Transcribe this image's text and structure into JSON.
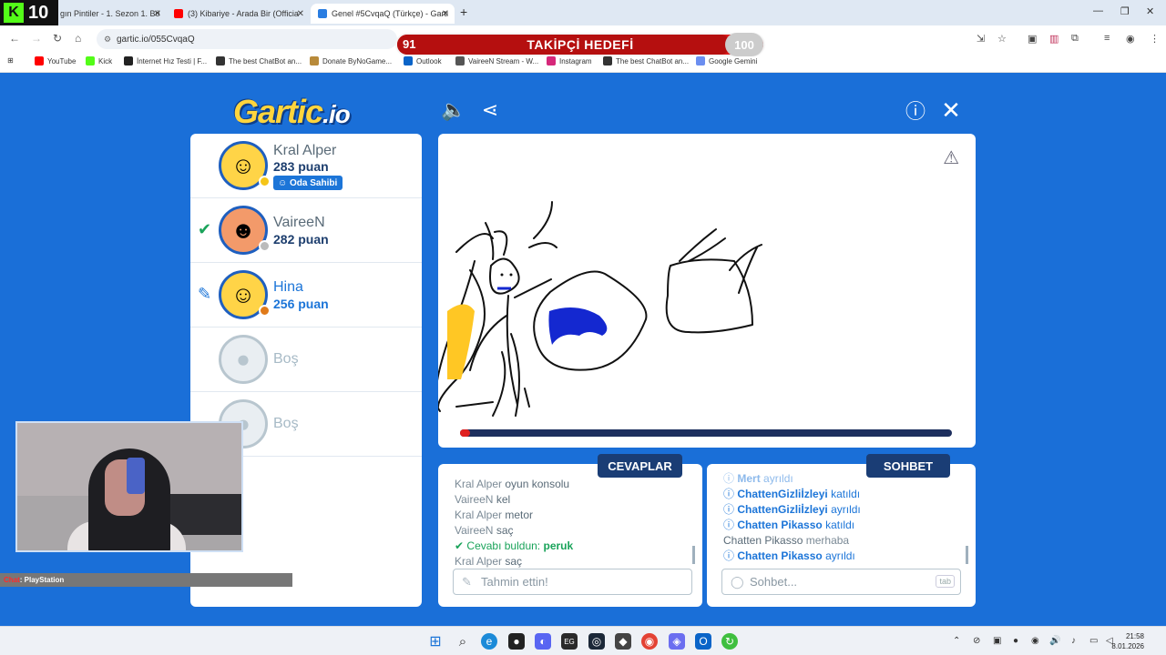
{
  "browser": {
    "tabs": [
      {
        "label": "gın Pintiler - 1. Sezon 1. Bö",
        "active": false
      },
      {
        "label": "(3) Kibariye - Arada Bir (Officia",
        "active": false
      },
      {
        "label": "Genel #5CvqaQ (Türkçe) - Garti",
        "active": true
      }
    ],
    "url": "gartic.io/055CvqaQ",
    "bookmarks": [
      "YouTube",
      "Kick",
      "İnternet Hız Testi | F...",
      "The best ChatBot an...",
      "Donate ByNoGame...",
      "Outlook",
      "VaireeN Stream - W...",
      "Instagram",
      "The best ChatBot an...",
      "Google Gemini"
    ]
  },
  "overlay": {
    "kick_count": "10",
    "goal_title": "TAKİPÇİ HEDEFİ",
    "goal_current": "91",
    "goal_target": "100",
    "goal_progress": 0.91
  },
  "game": {
    "logo_main": "Gartic",
    "logo_suffix": ".io",
    "players": [
      {
        "name": "Kral Alper",
        "points": "283 puan",
        "badge": "Oda Sahibi",
        "marker": "",
        "dot": "#f5c518"
      },
      {
        "name": "VaireeN",
        "points": "282 puan",
        "badge": "",
        "marker": "check",
        "dot": "#bbbbbb"
      },
      {
        "name": "Hina",
        "points": "256 puan",
        "badge": "",
        "marker": "pencil",
        "dot": "#e07a1a"
      },
      {
        "name": "Boş",
        "points": "",
        "badge": "",
        "marker": "",
        "dot": ""
      },
      {
        "name": "Boş",
        "points": "",
        "badge": "",
        "marker": "",
        "dot": ""
      }
    ],
    "timer_progress": 0.02,
    "answers": {
      "title": "CEVAPLAR",
      "placeholder": "Tahmin ettin!",
      "messages": [
        {
          "who": "Kral Alper",
          "text": "oyun konsolu"
        },
        {
          "who": "VaireeN",
          "text": "kel"
        },
        {
          "who": "Kral Alper",
          "text": "metor"
        },
        {
          "who": "VaireeN",
          "text": "saç"
        },
        {
          "who": "",
          "text": "Cevabı buldun:",
          "word": "peruk"
        },
        {
          "who": "Kral Alper",
          "text": "saç"
        }
      ]
    },
    "chat": {
      "title": "SOHBET",
      "placeholder": "Sohbet...",
      "tab_hint": "tab",
      "messages": [
        {
          "name": "Mert",
          "action": "ayrıldı",
          "system": true
        },
        {
          "name": "ChattenGizliİzleyi",
          "action": "katıldı",
          "system": true
        },
        {
          "name": "ChattenGizliİzleyi",
          "action": "ayrıldı",
          "system": true
        },
        {
          "name": "Chatten Pikasso",
          "action": "katıldı",
          "system": true
        },
        {
          "name": "Chatten Pikasso",
          "action": "merhaba",
          "system": false
        },
        {
          "name": "Chatten Pikasso",
          "action": "ayrıldı",
          "system": true
        }
      ]
    }
  },
  "webcam": {
    "ticker_user": "Chat",
    "ticker_text": ": PlayStation"
  },
  "taskbar": {
    "time": "21:58",
    "date": "8.01.2026"
  }
}
